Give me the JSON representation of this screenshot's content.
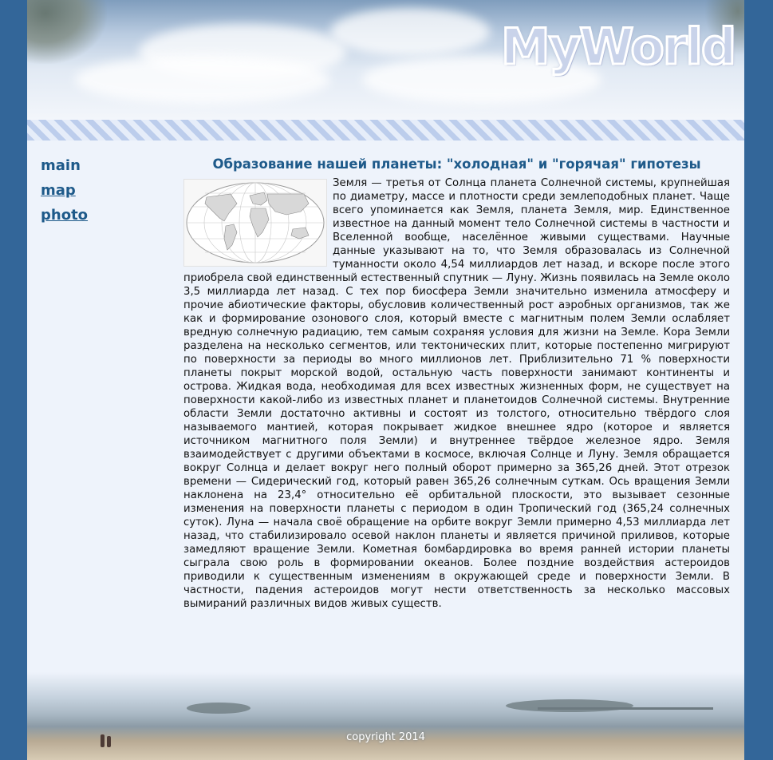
{
  "site": {
    "logo": "MyWorld"
  },
  "nav": {
    "items": [
      {
        "label": "main"
      },
      {
        "label": "map"
      },
      {
        "label": "photo"
      }
    ]
  },
  "article": {
    "title": "Образование нашей планеты: \"холодная\" и \"горячая\" гипотезы",
    "body": "Земля — третья от Солнца планета Солнечной системы, крупнейшая по диаметру, массе и плотности среди землеподобных планет. Чаще всего упоминается как Земля, планета Земля, мир. Единственное известное на данный момент тело Солнечной системы в частности и Вселенной вообще, населённое живыми существами. Научные данные указывают на то, что Земля образовалась из Солнечной туманности около 4,54 миллиардов лет назад, и вскоре после этого приобрела свой единственный естественный спутник — Луну. Жизнь появилась на Земле около 3,5 миллиарда лет назад. С тех пор биосфера Земли значительно изменила атмосферу и прочие абиотические факторы, обусловив количественный рост аэробных организмов, так же как и формирование озонового слоя, который вместе с магнитным полем Земли ослабляет вредную солнечную радиацию, тем самым сохраняя условия для жизни на Земле. Кора Земли разделена на несколько сегментов, или тектонических плит, которые постепенно мигрируют по поверхности за периоды во много миллионов лет. Приблизительно 71 % поверхности планеты покрыт морской водой, остальную часть поверхности занимают континенты и острова. Жидкая вода, необходимая для всех известных жизненных форм, не существует на поверхности какой-либо из известных планет и планетоидов Солнечной системы. Внутренние области Земли достаточно активны и состоят из толстого, относительно твёрдого слоя называемого мантией, которая покрывает жидкое внешнее ядро (которое и является источником магнитного поля Земли) и внутреннее твёрдое железное ядро. Земля взаимодействует с другими объектами в космосе, включая Солнце и Луну. Земля обращается вокруг Солнца и делает вокруг него полный оборот примерно за 365,26 дней. Этот отрезок времени — Сидерический год, который равен 365,26 солнечным суткам. Ось вращения Земли наклонена на 23,4° относительно её орбитальной плоскости, это вызывает сезонные изменения на поверхности планеты с периодом в один Тропический год (365,24 солнечных суток). Луна — начала своё обращение на орбите вокруг Земли примерно 4,53 миллиарда лет назад, что стабилизировало осевой наклон планеты и является причиной приливов, которые замедляют вращение Земли. Кометная бомбардировка во время ранней истории планеты сыграла свою роль в формировании океанов. Более поздние воздействия астероидов приводили к существенным изменениям в окружающей среде и поверхности Земли. В частности, падения астероидов могут нести ответственность за несколько массовых вымираний различных видов живых существ."
  },
  "footer": {
    "copyright": "copyright 2014"
  },
  "colors": {
    "side_bar": "#336699",
    "link": "#1e5a8a",
    "content_bg": "#eef3fb"
  }
}
